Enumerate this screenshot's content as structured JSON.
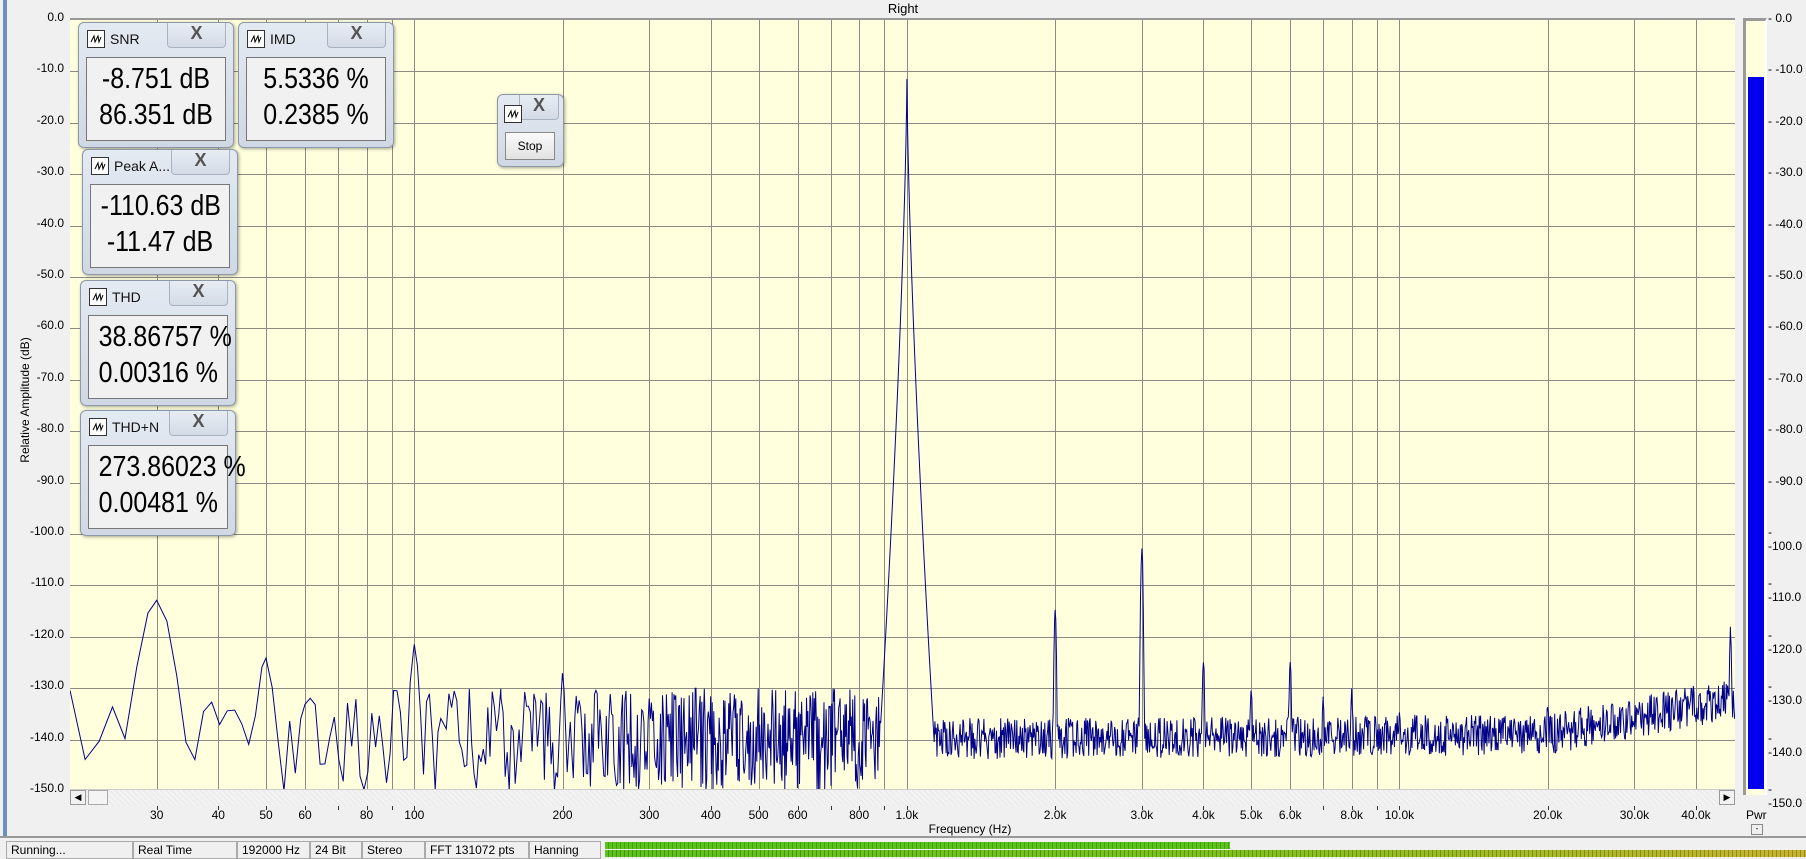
{
  "title": "Right",
  "y_axis": {
    "label": "Relative Amplitude (dB)",
    "ticks": [
      "0.0",
      "-10.0",
      "-20.0",
      "-30.0",
      "-40.0",
      "-50.0",
      "-60.0",
      "-70.0",
      "-80.0",
      "-90.0",
      "-100.0",
      "-110.0",
      "-120.0",
      "-130.0",
      "-140.0",
      "-150.0"
    ]
  },
  "x_axis": {
    "label": "Frequency (Hz)",
    "ticks": [
      {
        "f": 30,
        "label": "30"
      },
      {
        "f": 40,
        "label": "40"
      },
      {
        "f": 50,
        "label": "50"
      },
      {
        "f": 60,
        "label": "60"
      },
      {
        "f": 80,
        "label": "80"
      },
      {
        "f": 100,
        "label": "100"
      },
      {
        "f": 200,
        "label": "200"
      },
      {
        "f": 300,
        "label": "300"
      },
      {
        "f": 400,
        "label": "400"
      },
      {
        "f": 500,
        "label": "500"
      },
      {
        "f": 600,
        "label": "600"
      },
      {
        "f": 800,
        "label": "800"
      },
      {
        "f": 1000,
        "label": "1.0k"
      },
      {
        "f": 2000,
        "label": "2.0k"
      },
      {
        "f": 3000,
        "label": "3.0k"
      },
      {
        "f": 4000,
        "label": "4.0k"
      },
      {
        "f": 5000,
        "label": "5.0k"
      },
      {
        "f": 6000,
        "label": "6.0k"
      },
      {
        "f": 8000,
        "label": "8.0k"
      },
      {
        "f": 10000,
        "label": "10.0k"
      },
      {
        "f": 20000,
        "label": "20.0k"
      },
      {
        "f": 30000,
        "label": "30.0k"
      },
      {
        "f": 40000,
        "label": "40.0k"
      }
    ]
  },
  "chart_data": {
    "type": "line",
    "title": "Right",
    "xlabel": "Frequency (Hz)",
    "ylabel": "Relative Amplitude (dB)",
    "xscale": "log",
    "xlim": [
      20,
      48000
    ],
    "ylim": [
      -150,
      0
    ],
    "grid": true,
    "series_color": "#00008b",
    "fundamental": {
      "f": 1000,
      "db": -11.5
    },
    "peaks": [
      {
        "f": 30,
        "db": -111
      },
      {
        "f": 50,
        "db": -124
      },
      {
        "f": 60,
        "db": -132
      },
      {
        "f": 100,
        "db": -121
      },
      {
        "f": 150,
        "db": -130
      },
      {
        "f": 200,
        "db": -126
      },
      {
        "f": 250,
        "db": -130
      },
      {
        "f": 300,
        "db": -131
      },
      {
        "f": 2000,
        "db": -113
      },
      {
        "f": 3000,
        "db": -102
      },
      {
        "f": 4000,
        "db": -123
      },
      {
        "f": 5000,
        "db": -129
      },
      {
        "f": 6000,
        "db": -124
      },
      {
        "f": 7000,
        "db": -131
      },
      {
        "f": 8000,
        "db": -130
      },
      {
        "f": 10000,
        "db": -133
      },
      {
        "f": 20000,
        "db": -132
      },
      {
        "f": 47000,
        "db": -118
      }
    ],
    "noise_floor_db": [
      {
        "f": 20,
        "db": -140
      },
      {
        "f": 800,
        "db": -140
      },
      {
        "f": 20000,
        "db": -139
      },
      {
        "f": 48000,
        "db": -132
      }
    ]
  },
  "meter": {
    "label": "Pwr",
    "value_db": -11.47,
    "ticks": [
      "0.0",
      "-10.0",
      "-20.0",
      "-30.0",
      "-40.0",
      "-50.0",
      "-60.0",
      "-70.0",
      "-80.0",
      "-90.0",
      "-100.0",
      "-110.0",
      "-120.0",
      "-130.0",
      "-140.0",
      "-150.0"
    ],
    "fill_color": "#0000ee",
    "collapse": "-"
  },
  "widgets": [
    {
      "title": "SNR",
      "line1": "-8.751 dB",
      "line2": "86.351 dB"
    },
    {
      "title": "IMD",
      "line1": "5.5336 %",
      "line2": "0.2385 %"
    },
    {
      "title": "Peak A...",
      "line1": "-110.63 dB",
      "line2": "-11.47 dB"
    },
    {
      "title": "THD",
      "line1": "38.86757 %",
      "line2": "0.00316 %"
    },
    {
      "title": "THD+N",
      "line1": "273.86023 %",
      "line2": "0.00481 %"
    }
  ],
  "close_glyph": "X",
  "stop_label": "Stop",
  "status": {
    "state": "Running...",
    "mode": "Real Time",
    "rate": "192000 Hz",
    "bits": "24 Bit",
    "channels": "Stereo",
    "fft": "FFT 131072 pts",
    "window": "Hanning"
  },
  "scroll": {
    "left": "◀",
    "right": "▶"
  }
}
